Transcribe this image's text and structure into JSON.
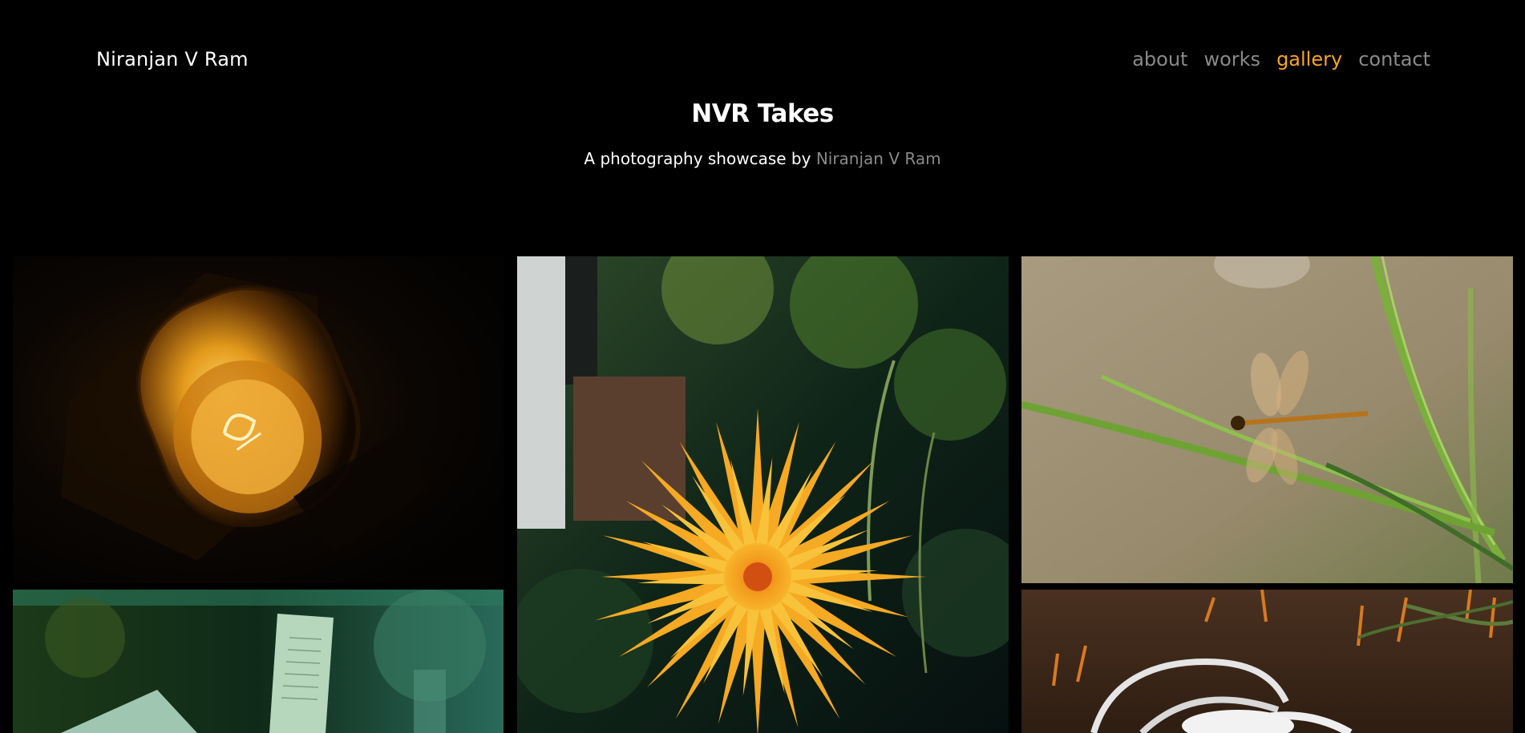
{
  "header": {
    "brand": "Niranjan V Ram",
    "nav": [
      {
        "label": "about",
        "active": false
      },
      {
        "label": "works",
        "active": false
      },
      {
        "label": "gallery",
        "active": true
      },
      {
        "label": "contact",
        "active": false
      }
    ]
  },
  "hero": {
    "title": "NVR Takes",
    "subtitle_prefix": "A photography showcase by",
    "subtitle_name": "Niranjan V Ram"
  },
  "gallery": {
    "photos": [
      {
        "subject": "lamp-bulb"
      },
      {
        "subject": "flower"
      },
      {
        "subject": "dragonfly"
      },
      {
        "subject": "book-page"
      },
      {
        "subject": "spider-lily"
      }
    ]
  },
  "colors": {
    "background": "#000000",
    "accent": "#f5a623",
    "muted": "#8a8a8a",
    "text": "#ffffff"
  }
}
